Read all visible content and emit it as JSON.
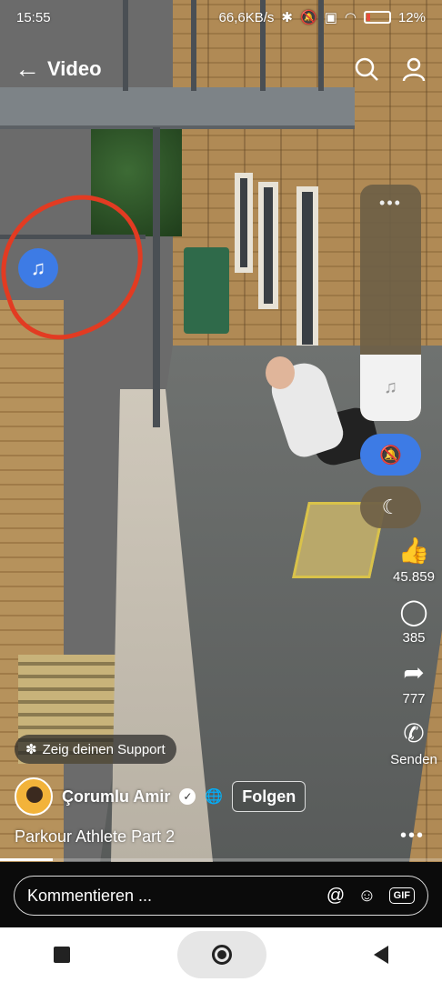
{
  "status_bar": {
    "time": "15:55",
    "network_speed": "66,6KB/s",
    "battery": "12%",
    "icons": [
      "bluetooth-icon",
      "mute-icon",
      "sim-icon",
      "wifi-icon",
      "battery-icon"
    ]
  },
  "header": {
    "title": "Video",
    "icons": [
      "back-arrow-icon",
      "search-icon",
      "profile-icon"
    ]
  },
  "music_button": {
    "icon": "music-note-icon"
  },
  "sound_panel": {
    "menu_icon": "more-dots-icon",
    "volume_level": 0.28,
    "level_icon": "music-note-icon",
    "mute_icon": "bell-mute-icon",
    "night_icon": "moon-icon",
    "accent": "#3d7be5"
  },
  "actions": {
    "like": {
      "count": "45.859",
      "icon": "thumbs-up-icon"
    },
    "comment": {
      "count": "385",
      "icon": "comment-bubble-icon"
    },
    "share": {
      "count": "777",
      "icon": "share-arrow-icon"
    },
    "whatsapp": {
      "label": "Senden",
      "icon": "whatsapp-icon"
    },
    "more_icon": "more-dots-icon"
  },
  "support_pill": {
    "text": "Zeig deinen Support",
    "icon": "sparkle-icon"
  },
  "author": {
    "name": "Çorumlu Amir",
    "follow_label": "Folgen",
    "verified_icon": "verified-badge-icon",
    "globe_icon": "globe-icon"
  },
  "caption": "Parkour Athlete Part 2",
  "progress": {
    "fraction": 0.12
  },
  "comment_bar": {
    "placeholder": "Kommentieren ...",
    "icons": [
      "at-icon",
      "emoji-icon",
      "gif-icon"
    ],
    "gif_label": "GIF"
  }
}
